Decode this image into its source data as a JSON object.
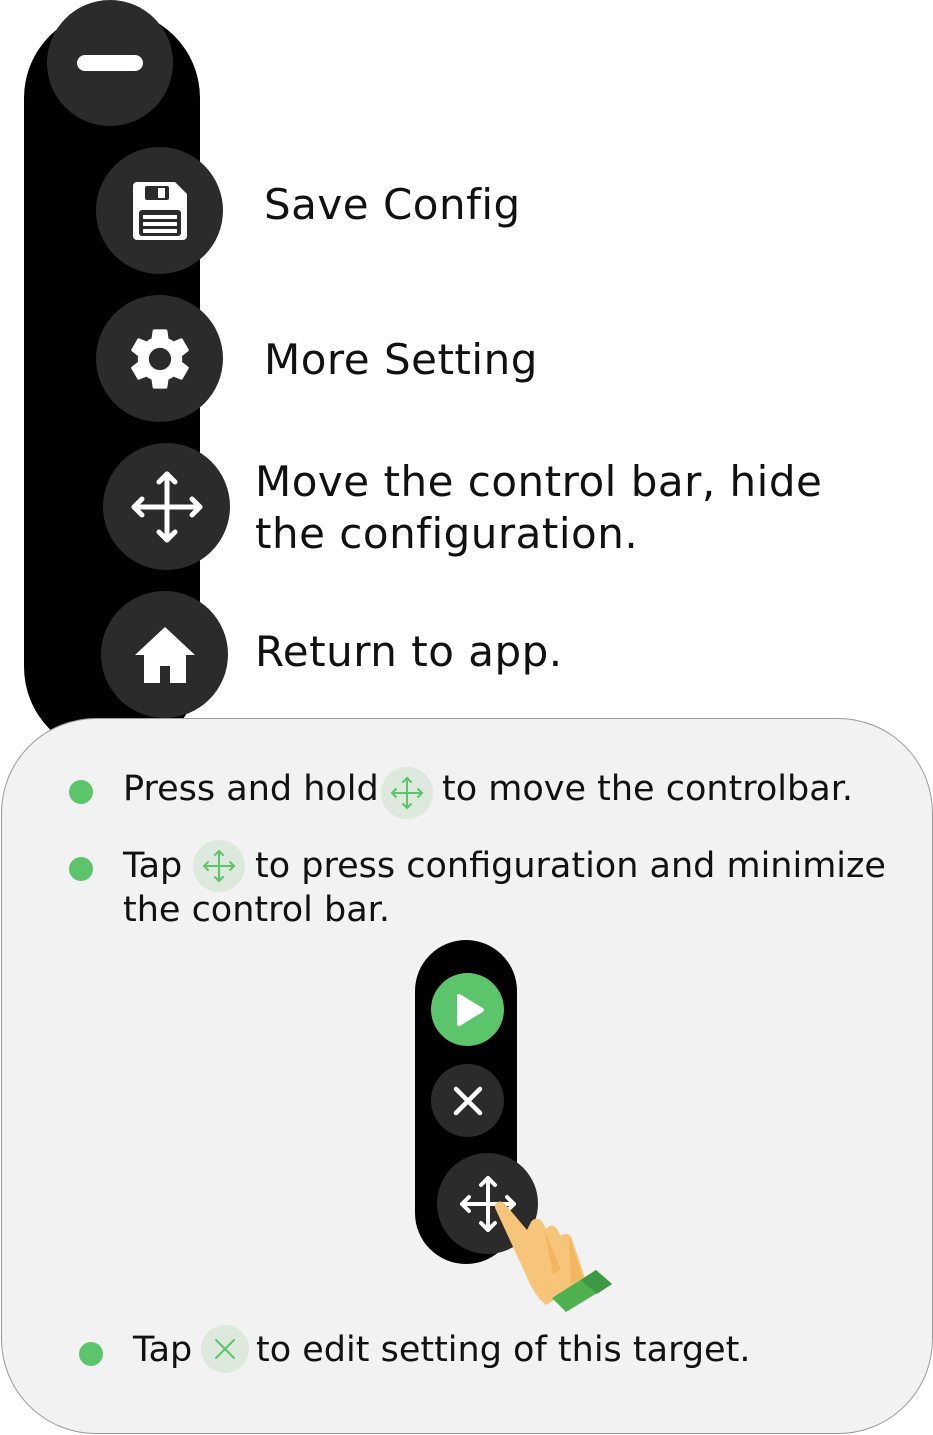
{
  "control_bar": {
    "items": [
      {
        "icon": "minus-icon",
        "label": ""
      },
      {
        "icon": "save-icon",
        "label": "Save Config"
      },
      {
        "icon": "gear-icon",
        "label": "More Setting"
      },
      {
        "icon": "move-icon",
        "label_line1": "Move the control bar, hide",
        "label_line2": "the configuration."
      },
      {
        "icon": "home-icon",
        "label": "Return to app."
      }
    ]
  },
  "instructions": {
    "item1": {
      "before": "Press and hold",
      "icon": "move-icon",
      "after": "to move the controlbar."
    },
    "item2": {
      "before": "Tap",
      "icon": "move-icon",
      "after": "to press configuration and minimize",
      "line2": "the control bar."
    },
    "item3": {
      "before": "Tap",
      "icon": "close-icon",
      "after": "to edit setting of this target."
    }
  },
  "mini_bar": {
    "buttons": [
      {
        "icon": "play-icon"
      },
      {
        "icon": "close-icon"
      },
      {
        "icon": "move-icon"
      }
    ]
  },
  "colors": {
    "accent_green": "#5cc46a",
    "bar_black": "#000000",
    "button_dark": "#2b2b2b",
    "panel_bg": "#f2f2f2",
    "hand_skin": "#f7b655",
    "sleeve_green": "#4fb050"
  }
}
